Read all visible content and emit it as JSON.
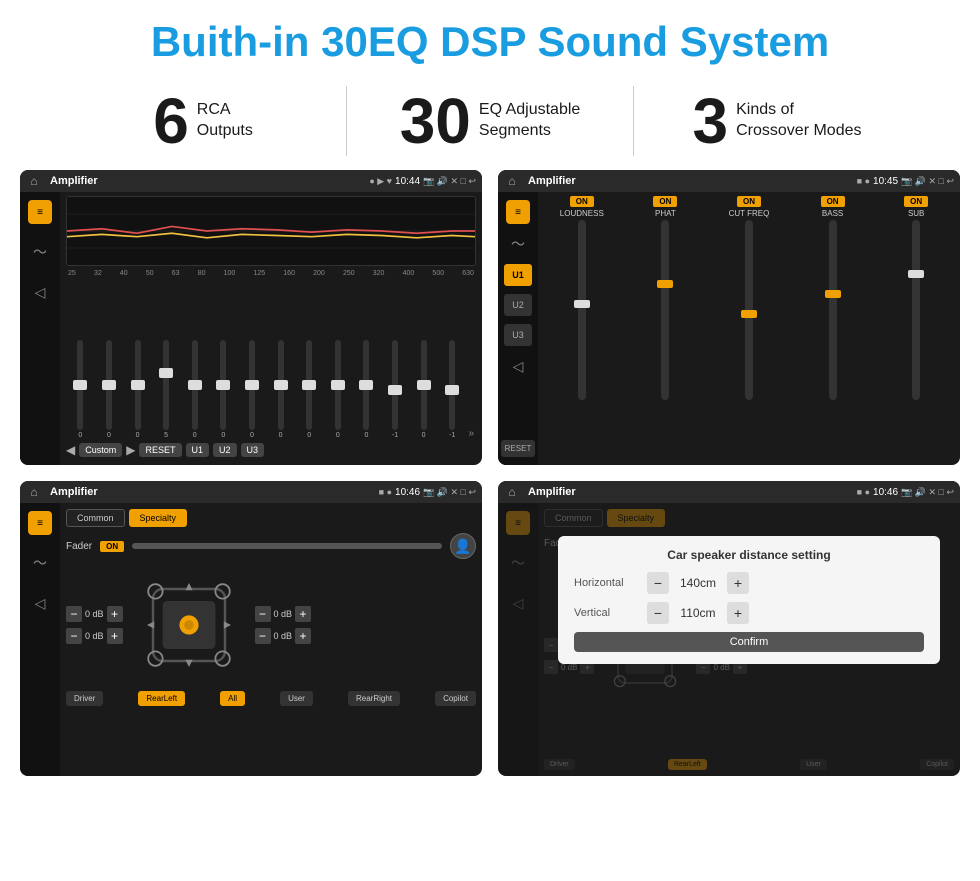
{
  "header": {
    "title": "Buith-in 30EQ DSP Sound System"
  },
  "stats": [
    {
      "number": "6",
      "label_line1": "RCA",
      "label_line2": "Outputs"
    },
    {
      "number": "30",
      "label_line1": "EQ Adjustable",
      "label_line2": "Segments"
    },
    {
      "number": "3",
      "label_line1": "Kinds of",
      "label_line2": "Crossover Modes"
    }
  ],
  "screen1": {
    "app_name": "Amplifier",
    "time": "10:44",
    "freq_labels": [
      "25",
      "32",
      "40",
      "50",
      "63",
      "80",
      "100",
      "125",
      "160",
      "200",
      "250",
      "320",
      "400",
      "500",
      "630"
    ],
    "eq_values": [
      "0",
      "0",
      "0",
      "5",
      "0",
      "0",
      "0",
      "0",
      "0",
      "0",
      "0",
      "-1",
      "0",
      "-1"
    ],
    "preset_label": "Custom",
    "btns": [
      "RESET",
      "U1",
      "U2",
      "U3"
    ]
  },
  "screen2": {
    "app_name": "Amplifier",
    "time": "10:45",
    "presets": [
      "U1",
      "U2",
      "U3"
    ],
    "channels": [
      "LOUDNESS",
      "PHAT",
      "CUT FREQ",
      "BASS",
      "SUB"
    ],
    "on_label": "ON"
  },
  "screen3": {
    "app_name": "Amplifier",
    "time": "10:46",
    "tabs": [
      "Common",
      "Specialty"
    ],
    "fader_label": "Fader",
    "on_label": "ON",
    "vol_labels": [
      "0 dB",
      "0 dB",
      "0 dB",
      "0 dB"
    ],
    "bottom_btns": [
      "Driver",
      "RearLeft",
      "All",
      "User",
      "RearRight",
      "Copilot"
    ]
  },
  "screen4": {
    "app_name": "Amplifier",
    "time": "10:46",
    "dialog_title": "Car speaker distance setting",
    "horizontal_label": "Horizontal",
    "horizontal_value": "140cm",
    "vertical_label": "Vertical",
    "vertical_value": "110cm",
    "confirm_label": "Confirm",
    "tabs": [
      "Common",
      "Specialty"
    ]
  }
}
